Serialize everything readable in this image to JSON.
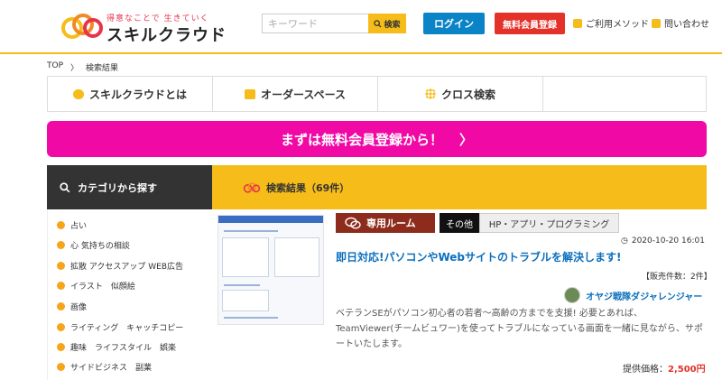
{
  "header": {
    "logo_tagline": "得意なことで 生きていく",
    "logo_name": "スキルクラウド",
    "search_placeholder": "キーワード",
    "search_button": "検索",
    "login": "ログイン",
    "register": "無料会員登録",
    "how_to_use": "ご利用メソッド",
    "contact": "問い合わせ"
  },
  "breadcrumb": [
    "TOP",
    "〉",
    "検索結果"
  ],
  "nav": [
    {
      "label": "スキルクラウドとは",
      "icon": "speech-bubble-icon"
    },
    {
      "label": "オーダースペース",
      "icon": "message-icon"
    },
    {
      "label": "クロス検索",
      "icon": "grid-icon"
    }
  ],
  "cta": {
    "label": "まずは無料会員登録から！",
    "arrow": "〉"
  },
  "category_bar": {
    "label": "カテゴリから探す"
  },
  "results_bar": {
    "label": "検索結果（69件）"
  },
  "sidebar": {
    "items": [
      "占い",
      "心 気持ちの相談",
      "拡散 アクセスアップ WEB広告",
      "イラスト　似顔絵",
      "画像",
      "ライティング　キャッチコピー",
      "趣味　ライフスタイル　娯楽",
      "サイドビジネス　副業"
    ]
  },
  "result": {
    "room_badge": "専用ルーム",
    "tag_other": "その他",
    "tag_category": "HP・アプリ・プログラミング",
    "date": "2020-10-20 16:01",
    "title": "即日対応!パソコンやWebサイトのトラブルを解決します!",
    "sales": "【販売件数：2件】",
    "seller": "オヤジ戦隊ダジャレンジャー",
    "description": "ベテランSEがパソコン初心者の若者〜高齢の方までを支援! 必要とあれば、TeamViewer(チームビュワー)を使ってトラブルになっている画面を一緒に見ながら、サポートいたします。",
    "price_label": "提供価格：",
    "price_value": "2,500円"
  },
  "colors": {
    "accent_yellow": "#f6bc1a",
    "cta_pink": "#f009a5",
    "login_blue": "#0b83c7",
    "register_red": "#e4322b",
    "room_brown": "#8d2c1c"
  }
}
